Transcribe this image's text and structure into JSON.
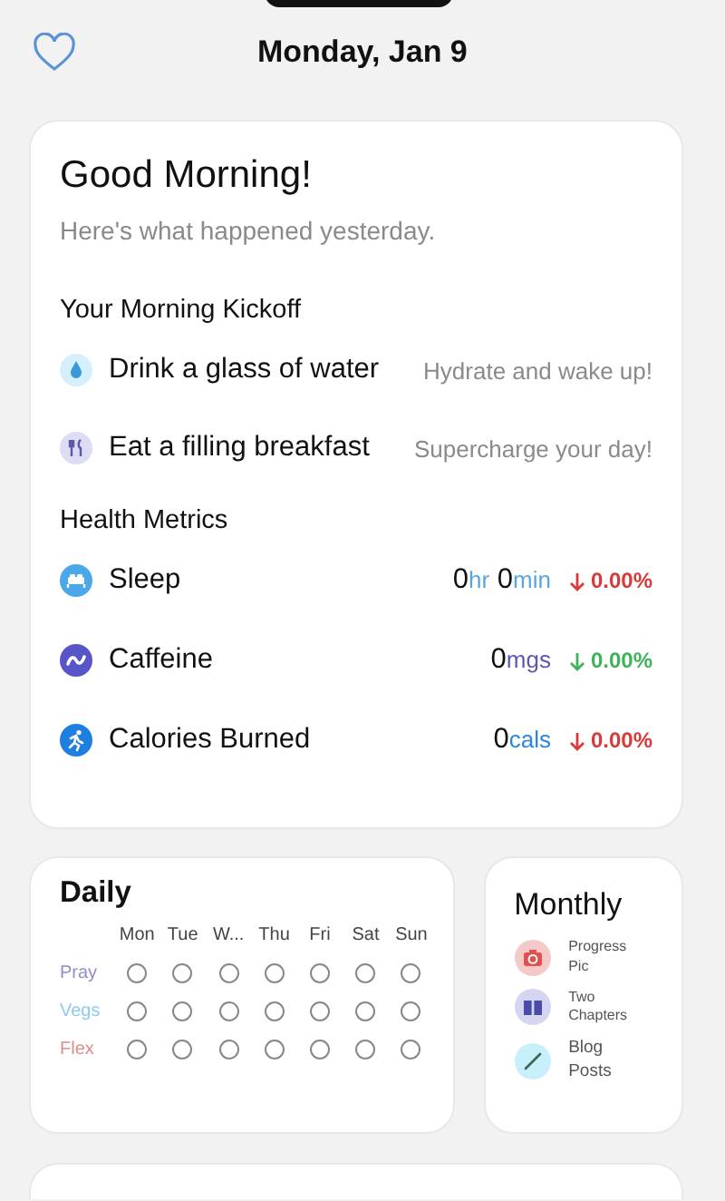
{
  "header": {
    "title": "Monday, Jan 9"
  },
  "summary": {
    "greeting": "Good Morning!",
    "subtitle": "Here's what happened yesterday.",
    "kickoff": {
      "title": "Your Morning Kickoff",
      "items": [
        {
          "kind": "water",
          "label": "Drink a glass of water",
          "note": "Hydrate and wake up!"
        },
        {
          "kind": "food",
          "label": "Eat a filling breakfast",
          "note": "Supercharge your day!"
        }
      ]
    },
    "metrics": {
      "title": "Health Metrics",
      "items": [
        {
          "kind": "sleep",
          "label": "Sleep",
          "parts": [
            {
              "value": "0",
              "unit": "hr"
            },
            {
              "value": "0",
              "unit": "min"
            }
          ],
          "change": "0.00%",
          "color": "#d83a3a"
        },
        {
          "kind": "caffeine",
          "label": "Caffeine",
          "parts": [
            {
              "value": "0",
              "unit": "mgs"
            }
          ],
          "change": "0.00%",
          "color": "#3fb35a"
        },
        {
          "kind": "calories",
          "label": "Calories Burned",
          "parts": [
            {
              "value": "0",
              "unit": "cals"
            }
          ],
          "change": "0.00%",
          "color": "#d83a3a"
        }
      ]
    }
  },
  "daily": {
    "title": "Daily",
    "days": [
      "Mon",
      "Tue",
      "W...",
      "Thu",
      "Fri",
      "Sat",
      "Sun"
    ],
    "rows": [
      {
        "label": "Pray",
        "color": "#8e8ec8",
        "checks": [
          false,
          false,
          false,
          false,
          false,
          false,
          false
        ]
      },
      {
        "label": "Vegs",
        "color": "#8ccbf0",
        "checks": [
          false,
          false,
          false,
          false,
          false,
          false,
          false
        ]
      },
      {
        "label": "Flex",
        "color": "#e08c8c",
        "checks": [
          false,
          false,
          false,
          false,
          false,
          false,
          false
        ]
      }
    ]
  },
  "monthly": {
    "title": "Monthly",
    "items": [
      {
        "kind": "camera",
        "label": "Progress Pic"
      },
      {
        "kind": "book",
        "label": "Two Chapters"
      },
      {
        "kind": "pencil",
        "label": "Blog Posts"
      }
    ]
  }
}
